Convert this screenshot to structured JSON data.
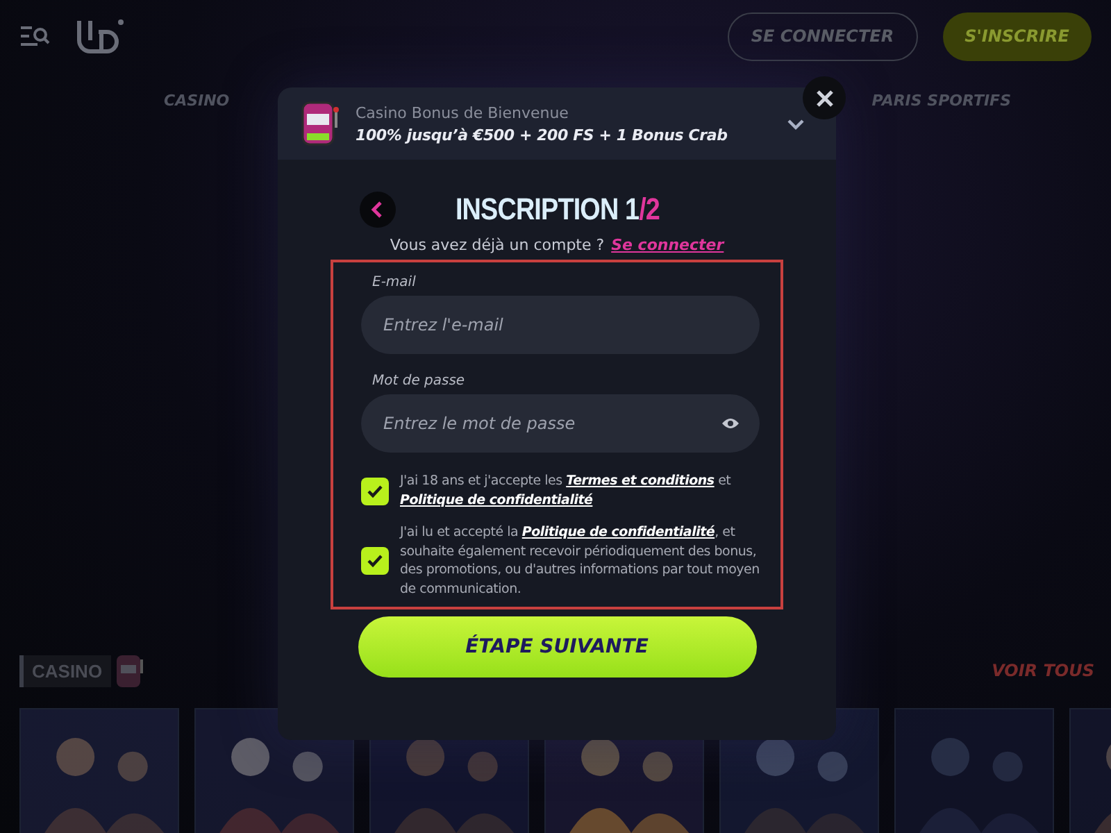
{
  "header": {
    "buttons": [
      {
        "label": "SE CONNECTER",
        "kind": "outline"
      },
      {
        "label": "S'INSCRIRE",
        "kind": "filled"
      }
    ]
  },
  "nav": [
    {
      "label": "CASINO"
    },
    {
      "label": "PARIS SPORTIFS"
    }
  ],
  "casino_section": {
    "badge": "CASINO",
    "see_all": "VOIR TOUS"
  },
  "modal": {
    "bonus": {
      "label": "Casino Bonus de Bienvenue",
      "offer": "100% jusqu’à €500 + 200 FS + 1 Bonus Crab",
      "expanded": false
    },
    "title": "INSCRIPTION 1",
    "step_suffix": "/2",
    "login_prompt": "Vous avez déjà un compte ?",
    "login_link": "Se connecter",
    "fields": [
      {
        "label": "E-mail",
        "placeholder": "Entrez l'e-mail",
        "kind": "text"
      },
      {
        "label": "Mot de passe",
        "placeholder": "Entrez le mot de passe",
        "kind": "password"
      }
    ],
    "consents": [
      {
        "checked": true,
        "parts": [
          {
            "text": "J'ai 18 ans et j'accepte les "
          },
          {
            "text": "Termes et conditions",
            "link": true
          },
          {
            "text": " et "
          },
          {
            "text": "Politique de confidentialité",
            "link": true
          }
        ]
      },
      {
        "checked": true,
        "parts": [
          {
            "text": "J'ai lu et accepté la "
          },
          {
            "text": "Politique de confidentialité",
            "link": true
          },
          {
            "text": ", et souhaite également recevoir périodiquement des bonus, des promotions, ou d'autres informations par tout moyen de communication."
          }
        ]
      }
    ],
    "submit": "ÉTAPE SUIVANTE"
  }
}
